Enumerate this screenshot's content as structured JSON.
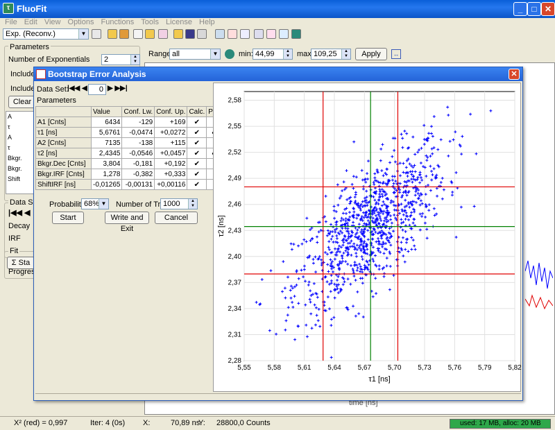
{
  "app": {
    "title": "FluoFit"
  },
  "menu": [
    "File",
    "Edit",
    "View",
    "Options",
    "Functions",
    "Tools",
    "License",
    "Help"
  ],
  "toolbar": {
    "model_value": "Exp. (Reconv.)"
  },
  "left_panel": {
    "parameters_group": "Parameters",
    "num_exp_label": "Number of Exponentials",
    "num_exp_value": "2",
    "include_s_label": "Include S",
    "include_c_label": "Include C",
    "clear_label": "Clear",
    "row_labels": [
      "A",
      "τ",
      "A",
      "τ",
      "Bkgr.",
      "Bkgr.",
      "Shift"
    ],
    "data_sets_group": "Data Sets",
    "decay_label": "Decay",
    "irf_label": "IRF",
    "fit_group": "Fit",
    "start_label": "Sta",
    "progress_label": "Progress:"
  },
  "range_bar": {
    "range_label": "Range:",
    "range_value": "all",
    "min_label": "min:",
    "min_value": "44,99",
    "max_label": "max:",
    "max_value": "109,25",
    "apply_label": "Apply"
  },
  "main_plot": {
    "xlabel": "time [ns]"
  },
  "dialog": {
    "title": "Bootstrap Error Analysis",
    "data_set_label": "Data Set:",
    "data_set_value": "0",
    "parameters_label": "Parameters",
    "table_headers": [
      "",
      "Value",
      "Conf. Lw.",
      "Conf. Up.",
      "Calc.",
      "Plot"
    ],
    "rows": [
      {
        "name": "A1 [Cnts]",
        "value": "6434",
        "lw": "-129",
        "up": "+169",
        "calc": "✔",
        "plot": ""
      },
      {
        "name": "τ1 [ns]",
        "value": "5,6761",
        "lw": "-0,0474",
        "up": "+0,0272",
        "calc": "✔",
        "plot": "✔"
      },
      {
        "name": "A2 [Cnts]",
        "value": "7135",
        "lw": "-138",
        "up": "+115",
        "calc": "✔",
        "plot": ""
      },
      {
        "name": "τ2 [ns]",
        "value": "2,4345",
        "lw": "-0,0546",
        "up": "+0,0457",
        "calc": "✔",
        "plot": "✔"
      },
      {
        "name": "Bkgr.Dec [Cnts]",
        "value": "3,804",
        "lw": "-0,181",
        "up": "+0,192",
        "calc": "✔",
        "plot": ""
      },
      {
        "name": "Bkgr.IRF [Cnts]",
        "value": "1,278",
        "lw": "-0,382",
        "up": "+0,333",
        "calc": "✔",
        "plot": ""
      },
      {
        "name": "ShiftIRF [ns]",
        "value": "-0,01265",
        "lw": "-0,00131",
        "up": "+0,00116",
        "calc": "✔",
        "plot": ""
      }
    ],
    "probability_label": "Probability:",
    "probability_value": "68%",
    "tries_label": "Number of Tries:",
    "tries_value": "1000",
    "start_button": "Start",
    "write_exit_button": "Write and Exit",
    "cancel_button": "Cancel"
  },
  "chart_data": {
    "type": "scatter",
    "xlabel": "τ1 [ns]",
    "ylabel": "τ2 [ns]",
    "xlim": [
      5.55,
      5.82
    ],
    "ylim": [
      2.28,
      2.59
    ],
    "xticks": [
      "5,55",
      "5,58",
      "5,61",
      "5,64",
      "5,67",
      "5,70",
      "5,73",
      "5,76",
      "5,79",
      "5,82"
    ],
    "yticks": [
      "2,28",
      "2,31",
      "2,34",
      "2,37",
      "2,40",
      "2,43",
      "2,46",
      "2,49",
      "2,52",
      "2,55",
      "2,58"
    ],
    "grid": true,
    "point_color": "#0000ff",
    "vlines": [
      {
        "x": 5.6287,
        "color": "#e00000"
      },
      {
        "x": 5.6761,
        "color": "#008000"
      },
      {
        "x": 5.7033,
        "color": "#e00000"
      }
    ],
    "hlines": [
      {
        "y": 2.3799,
        "color": "#e00000"
      },
      {
        "y": 2.4345,
        "color": "#008000"
      },
      {
        "y": 2.4802,
        "color": "#e00000"
      }
    ],
    "points": {
      "count": 1000,
      "center": [
        5.6761,
        2.4345
      ],
      "std": [
        0.038,
        0.048
      ],
      "correlation": 0.7
    }
  },
  "status": {
    "chi2": "X² (red) = 0,997",
    "iter": "Iter: 4 (0s)",
    "x_label": "X:",
    "x_value": "70,89 ns",
    "y_label": "Y:",
    "y_value": "28800,0  Counts",
    "memory": "used: 17 MB, alloc: 20 MB"
  },
  "colors": {
    "titlebar": "#0a5fd8",
    "dialog_title": "#2463d8",
    "accent_red": "#e00000",
    "accent_green": "#008000",
    "points": "#0000ff"
  }
}
